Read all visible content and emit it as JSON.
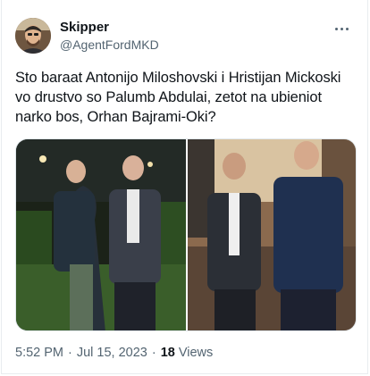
{
  "author": {
    "display_name": "Skipper",
    "handle": "@AgentFordMKD"
  },
  "tweet": {
    "text": "Sto baraat Antonijo Miloshovski i Hristijan Mickoski\nvo drustvo so Palumb Abdulai, zetot na ubieniot\nnarko bos, Orhan Bajrami-Oki?"
  },
  "meta": {
    "time": "5:52 PM",
    "separator": "·",
    "date": "Jul 15, 2023",
    "views_count": "18",
    "views_label": "Views"
  },
  "icons": {
    "more": "more-horizontal-icon",
    "avatar": "avatar-icon"
  },
  "colors": {
    "text_primary": "#0f1419",
    "text_secondary": "#536471",
    "border": "#e1e8ed"
  }
}
